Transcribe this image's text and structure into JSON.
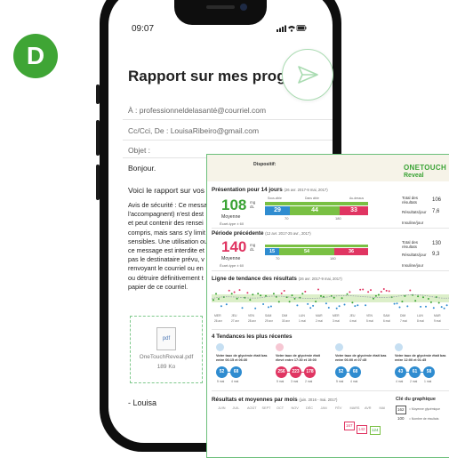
{
  "step_badge": "D",
  "colors": {
    "badge_green": "#3fa535",
    "brand_green": "#3aa335",
    "blue": "#2f8cd0",
    "green": "#79c043",
    "pink": "#e03562",
    "ring_green": "#a9dbb1"
  },
  "status_bar": {
    "time": "09:07",
    "icons": "signal-wifi-battery"
  },
  "email": {
    "title": "Rapport sur mes progrès",
    "to": "À : professionneldelasanté@courriel.com",
    "cc": "Cc/Cci, De : LouisaRibeiro@gmail.com",
    "subject_placeholder": "Objet :",
    "greeting": "Bonjour.",
    "intro": "Voici le rapport sur vos",
    "body_lines": [
      "Avis de sécurité : Ce messa",
      "l'accompagnent) n'est dest",
      "et peut contenir des rensei",
      "compris, mais sans s'y limit",
      "sensibles. Une utilisation ou",
      "ce message est interdite et",
      "pas le destinataire prévu, v",
      "renvoyant le courriel ou en",
      "ou détruire définitivement t",
      "papier de ce courriel."
    ],
    "attachment": {
      "type": "pdf",
      "name": "OneTouchReveal.pdf",
      "size": "189 Ko"
    },
    "signoff": "- Louisa",
    "send_icon": "paper-plane-icon"
  },
  "report": {
    "device_label": "Dispositif:",
    "logo_line1": "ONETOUCH",
    "logo_line2": "Reveal",
    "section1": {
      "heading": "Présentation pour 14 jours",
      "date_range": "(26 avr. 2017-9 mai, 2017)",
      "average": "108",
      "unit_top": "mg",
      "unit_bottom": "dL",
      "average_label": "Moyenne",
      "sd_label": "Écart-type ± 60",
      "bar_values": [
        "29",
        "44",
        "33"
      ],
      "bar_caption_left": "Sous-cible",
      "bar_caption_mid": "Dans cible",
      "bar_caption_right": "Au-dessus",
      "thresholds": [
        "70",
        "180"
      ],
      "summary": [
        {
          "label": "Total des résultats",
          "value": "106"
        },
        {
          "label": "Résultats/jour",
          "value": "7,6"
        },
        {
          "label": "Insuline/jour",
          "value": ""
        }
      ]
    },
    "section2": {
      "heading": "Période précédente",
      "date_range": "(12 avr. 2017-25 avr., 2017)",
      "average": "140",
      "unit_top": "mg",
      "unit_bottom": "dL",
      "average_label": "Moyenne",
      "sd_label": "Écart-type ± 60",
      "bar_values": [
        "15",
        "54",
        "36"
      ],
      "thresholds": [
        "70",
        "180"
      ],
      "summary": [
        {
          "label": "Total des résultats",
          "value": "130"
        },
        {
          "label": "Résultats/jour",
          "value": "9,3"
        },
        {
          "label": "Insuline/jour",
          "value": ""
        }
      ]
    },
    "section3": {
      "heading": "Ligne de tendance des résultats",
      "date_range": "(26 avr. 2017-9 mai, 2017)",
      "day_labels": [
        "MER",
        "JEU",
        "VEN",
        "SAM",
        "DIM",
        "LUN",
        "MAR",
        "MER",
        "JEU",
        "VEN",
        "SAM",
        "DIM",
        "LUN",
        "MAR"
      ],
      "date_labels": [
        "26 avr",
        "27 avr",
        "28 avr",
        "29 avr",
        "30 avr",
        "1 mai",
        "2 mai",
        "3 mai",
        "4 mai",
        "5 mai",
        "6 mai",
        "7 mai",
        "8 mai",
        "9 mai"
      ]
    },
    "section4": {
      "heading": "4 Tendances les plus récentes",
      "cards": [
        {
          "text": "Votre taux de glycémie était bas entre 06:15 et 06:30",
          "values": [
            "52",
            "68"
          ],
          "dates": [
            "5 mai",
            "4 mai"
          ],
          "color": "#2f8cd0"
        },
        {
          "text": "Votre taux de glycémie était élevé entre 17:30 et 19:00",
          "values": [
            "256",
            "223",
            "178"
          ],
          "dates": [
            "5 mai",
            "3 mai",
            "2 mai"
          ],
          "color": "#e03562"
        },
        {
          "text": "Votre taux de glycémie était bas entre 06:00 et 07:45",
          "values": [
            "52",
            "68"
          ],
          "dates": [
            "5 mai",
            "4 mai"
          ],
          "color": "#2f8cd0"
        },
        {
          "text": "Votre taux de glycémie était bas entre 12:00 et 01:45",
          "values": [
            "43",
            "61",
            "58"
          ],
          "dates": [
            "4 mai",
            "2 mai",
            "1 mai"
          ],
          "color": "#2f8cd0"
        }
      ]
    },
    "section5": {
      "heading": "Résultats et moyennes par mois",
      "date_range": "(juin. 2016 - mai. 2017)",
      "months": [
        "JUIN",
        "JUIL",
        "AOÛT",
        "SEPT",
        "OCT",
        "NOV",
        "DÉC",
        "JAN",
        "FÉV",
        "MARS",
        "AVR",
        "MAI"
      ],
      "box_values": [
        "167",
        "142",
        "124"
      ]
    },
    "legend": {
      "heading": "Clé du graphique",
      "item1_value": "162",
      "item1_label": "= Moyenne glycémique",
      "item2_value": "100",
      "item2_label": "= Nombre de résultats"
    }
  }
}
